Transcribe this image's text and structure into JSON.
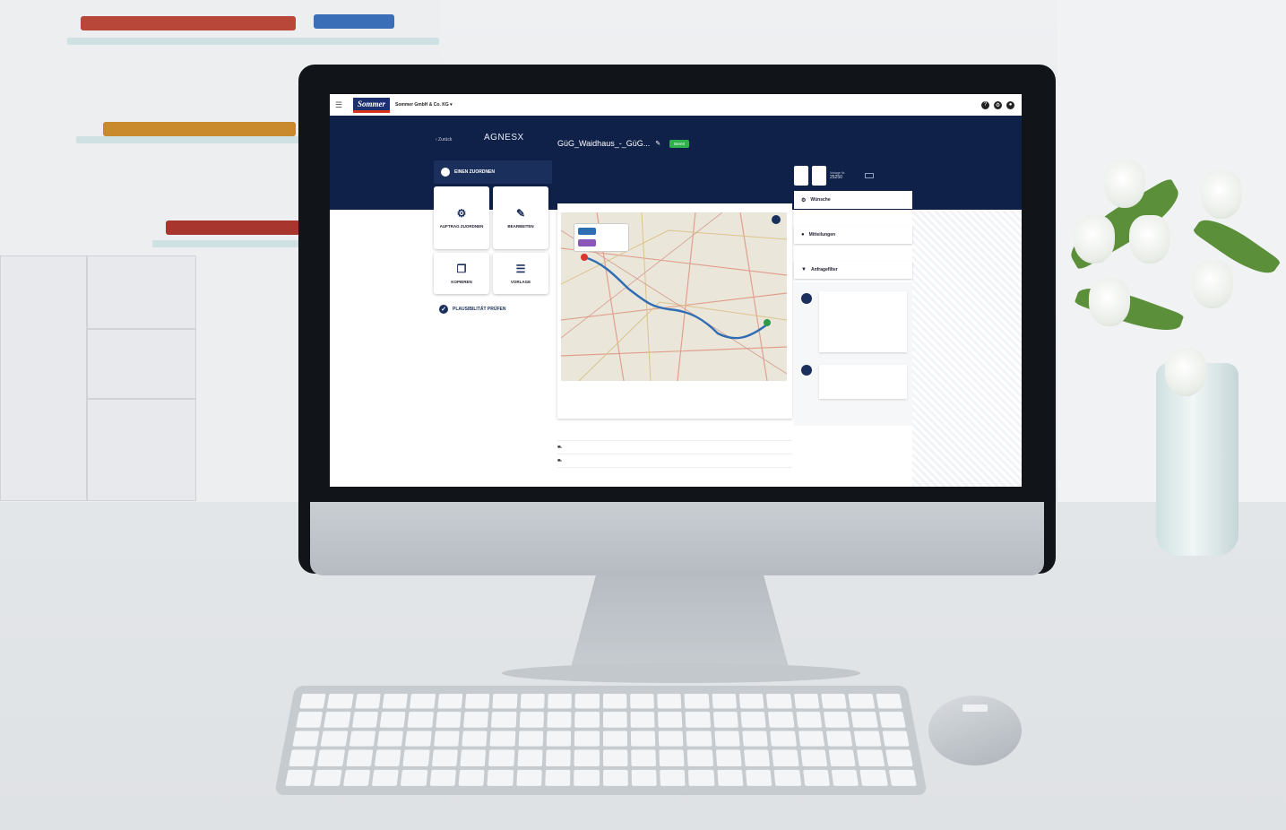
{
  "app": {
    "company_label": "Sommer GmbH & Co. KG ▾",
    "logo_text": "Sommer",
    "back_label": "‹ Zurück",
    "title": "AGNESX"
  },
  "left_panel": {
    "assign_button": "EINEN ZUORDNEN",
    "tiles": [
      {
        "label": "AUFTRAG ZUORDNEN",
        "icon": "gear-icon"
      },
      {
        "label": "BEARBEITEN",
        "icon": "edit-icon"
      },
      {
        "label": "KOPIEREN",
        "icon": "copy-icon"
      },
      {
        "label": "VORLAGE",
        "icon": "list-icon"
      }
    ],
    "plausibility_button": "PLAUSIBILITÄT PRÜFEN"
  },
  "vehicle": {
    "name": "GüG_Waidhaus_-_GüG...",
    "status_badge": "Bereit"
  },
  "reference": {
    "label": "Vorlage Nr.",
    "number": "25250"
  },
  "right_panel": {
    "panels": [
      {
        "label": "Wünsche",
        "icon": "gear-icon"
      },
      {
        "label": "Mitteilungen",
        "icon": "chat-icon"
      },
      {
        "label": "Anfragefilter",
        "icon": "filter-icon"
      }
    ]
  },
  "colors": {
    "header_navy": "#0f2148",
    "accent_blue": "#1b2f5c",
    "route_blue": "#2f6db3",
    "status_green": "#2db34a",
    "logo_red": "#dd3322"
  }
}
